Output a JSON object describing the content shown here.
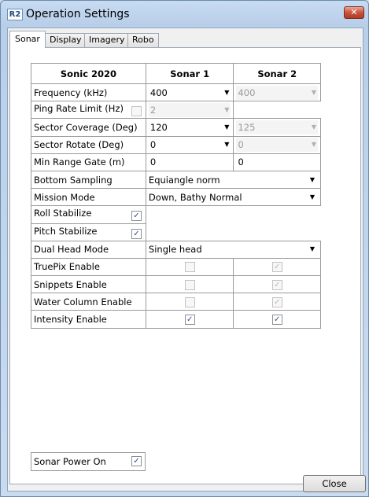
{
  "window": {
    "title": "Operation Settings",
    "logo_text": "R2",
    "close_glyph": "✕"
  },
  "tabs": [
    {
      "label": "Sonar",
      "active": true
    },
    {
      "label": "Display"
    },
    {
      "label": "Imagery"
    },
    {
      "label": "Robo"
    }
  ],
  "grid": {
    "header": {
      "title": "Sonic 2020",
      "col1": "Sonar 1",
      "col2": "Sonar 2"
    },
    "frequency": {
      "label": "Frequency (kHz)",
      "sonar1": "400",
      "sonar2": "400"
    },
    "ping_rate": {
      "label": "Ping Rate Limit (Hz)",
      "sonar1": "2"
    },
    "sector_coverage": {
      "label": "Sector Coverage (Deg)",
      "sonar1": "120",
      "sonar2": "125"
    },
    "sector_rotate": {
      "label": "Sector Rotate (Deg)",
      "sonar1": "0",
      "sonar2": "0"
    },
    "min_range": {
      "label": "Min Range Gate (m)",
      "sonar1": "0",
      "sonar2": "0"
    },
    "bottom_sampling": {
      "label": "Bottom Sampling",
      "value": "Equiangle norm"
    },
    "mission_mode": {
      "label": "Mission Mode",
      "value": "Down, Bathy Normal"
    },
    "roll_stabilize": {
      "label": "Roll Stabilize",
      "checked": true
    },
    "pitch_stabilize": {
      "label": "Pitch Stabilize",
      "checked": true
    },
    "dual_head": {
      "label": "Dual Head Mode",
      "value": "Single head"
    },
    "truepix": {
      "label": "TruePix Enable",
      "sonar1": false,
      "sonar2": true
    },
    "snippets": {
      "label": "Snippets Enable",
      "sonar1": false,
      "sonar2": true
    },
    "water_column": {
      "label": "Water Column Enable",
      "sonar1": false,
      "sonar2": true
    },
    "intensity": {
      "label": "Intensity Enable",
      "sonar1": true,
      "sonar2": true
    }
  },
  "power": {
    "label": "Sonar Power On",
    "checked": true
  },
  "buttons": {
    "close": "Close"
  },
  "icons": {
    "dropdown": "▼",
    "check": "✓"
  }
}
